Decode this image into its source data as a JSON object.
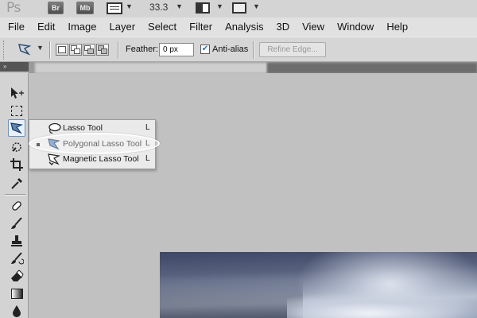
{
  "app": {
    "logo": "Ps",
    "bridge_button": "Br",
    "minibridge_button": "Mb",
    "zoom_level": "33.3"
  },
  "menu": {
    "items": [
      "File",
      "Edit",
      "Image",
      "Layer",
      "Select",
      "Filter",
      "Analysis",
      "3D",
      "View",
      "Window",
      "Help"
    ]
  },
  "options": {
    "feather_label": "Feather:",
    "feather_value": "0 px",
    "antialias_label": "Anti-alias",
    "antialias_checked": true,
    "refine_edge_label": "Refine Edge..."
  },
  "tools_panel": {
    "collapse_glyph": "»"
  },
  "flyout": {
    "items": [
      {
        "label": "Lasso Tool",
        "shortcut": "L",
        "icon": "lasso-icon",
        "selected": false
      },
      {
        "label": "Polygonal Lasso Tool",
        "shortcut": "L",
        "icon": "polygonal-lasso-icon",
        "selected": true
      },
      {
        "label": "Magnetic Lasso Tool",
        "shortcut": "L",
        "icon": "magnetic-lasso-icon",
        "selected": false
      }
    ]
  },
  "colors": {
    "accent_highlight": "#6f8fb6",
    "workspace_gray": "#c1c1c1",
    "menubar_bg": "#e1e1e1"
  }
}
